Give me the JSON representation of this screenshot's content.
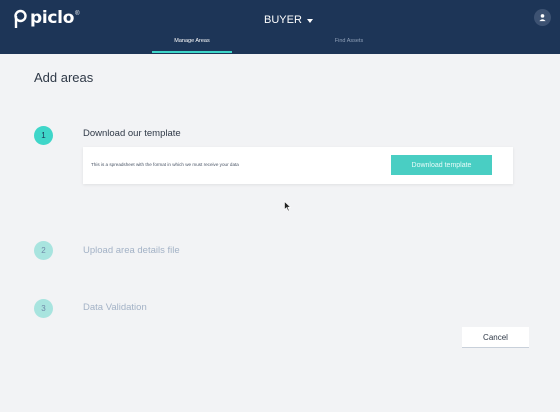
{
  "header": {
    "logo_text": "piclo",
    "logo_mark": "®",
    "role_label": "BUYER",
    "tabs": [
      {
        "label": "Manage Areas",
        "active": true
      },
      {
        "label": "Find Assets",
        "active": false
      }
    ]
  },
  "page": {
    "title": "Add areas"
  },
  "steps": [
    {
      "number": "1",
      "label": "Download our template",
      "state": "active"
    },
    {
      "number": "2",
      "label": "Upload area details file",
      "state": "inactive"
    },
    {
      "number": "3",
      "label": "Data Validation",
      "state": "inactive"
    }
  ],
  "template_card": {
    "description": "This is a spreadsheet with the format in which we must receive your data",
    "download_button": "Download template"
  },
  "actions": {
    "cancel": "Cancel"
  },
  "colors": {
    "header_bg": "#1d3557",
    "accent": "#3fd6c9",
    "page_bg": "#f2f3f5"
  },
  "icons": {
    "logo": "piclo-logo-icon",
    "account": "user-icon",
    "dropdown": "caret-down-icon",
    "cursor": "mouse-pointer-icon"
  }
}
